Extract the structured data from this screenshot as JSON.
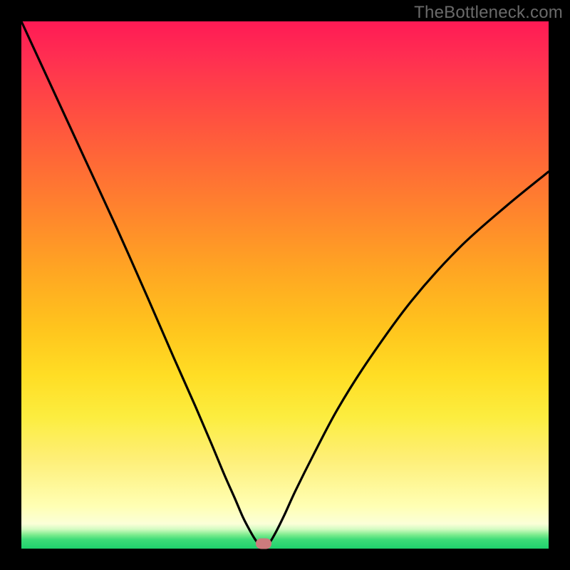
{
  "watermark": "TheBottleneck.com",
  "chart_data": {
    "type": "line",
    "title": "",
    "xlabel": "",
    "ylabel": "",
    "xlim": [
      0,
      1
    ],
    "ylim": [
      0,
      1
    ],
    "grid": false,
    "legend": false,
    "background": {
      "kind": "vertical_gradient",
      "stops": [
        {
          "pos": 0.0,
          "color": "#ff1a55"
        },
        {
          "pos": 0.27,
          "color": "#ff6a36"
        },
        {
          "pos": 0.58,
          "color": "#ffc41d"
        },
        {
          "pos": 0.83,
          "color": "#feef77"
        },
        {
          "pos": 0.95,
          "color": "#fbffd8"
        },
        {
          "pos": 0.975,
          "color": "#7beb8d"
        },
        {
          "pos": 1.0,
          "color": "#1fd16d"
        }
      ]
    },
    "series": [
      {
        "name": "bottleneck-curve",
        "color": "#000000",
        "x": [
          0.0,
          0.06,
          0.12,
          0.18,
          0.24,
          0.29,
          0.33,
          0.36,
          0.385,
          0.405,
          0.42,
          0.433,
          0.443,
          0.452,
          0.46,
          0.47,
          0.482,
          0.498,
          0.52,
          0.555,
          0.6,
          0.66,
          0.74,
          0.83,
          0.92,
          1.0
        ],
        "y": [
          1.0,
          0.87,
          0.74,
          0.61,
          0.475,
          0.36,
          0.27,
          0.2,
          0.14,
          0.095,
          0.06,
          0.035,
          0.018,
          0.006,
          0.0,
          0.01,
          0.03,
          0.062,
          0.11,
          0.18,
          0.265,
          0.36,
          0.47,
          0.57,
          0.65,
          0.715
        ]
      }
    ],
    "marker": {
      "x": 0.46,
      "y": 0.01,
      "color": "#cc7b7d"
    }
  }
}
